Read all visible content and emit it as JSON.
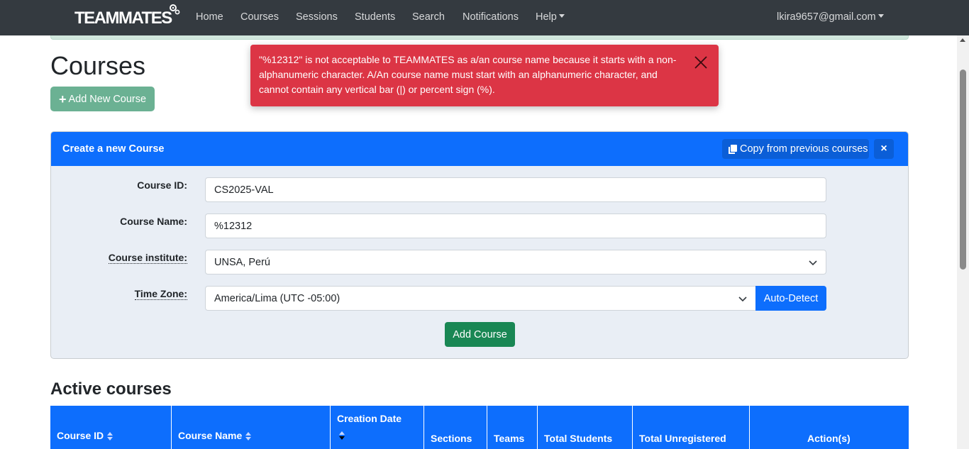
{
  "navbar": {
    "brand": "TEAMMATES",
    "links": [
      "Home",
      "Courses",
      "Sessions",
      "Students",
      "Search",
      "Notifications"
    ],
    "help": "Help",
    "user": "lkira9657@gmail.com"
  },
  "page": {
    "title": "Courses",
    "add_button": "Add New Course"
  },
  "toast": {
    "message": "\"%12312\" is not acceptable to TEAMMATES as a/an course name because it starts with a non-alphanumeric character. A/An course name must start with an alphanumeric character, and cannot contain any vertical bar (|) or percent sign (%).",
    "color": "#dc3545"
  },
  "form": {
    "title": "Create a new Course",
    "copy_button": "Copy from previous courses",
    "close_icon": "×",
    "course_id_label": "Course ID:",
    "course_id_value": "CS2025-VAL",
    "course_name_label": "Course Name:",
    "course_name_value": "%12312",
    "institute_label": "Course institute:",
    "institute_value": "UNSA, Perú",
    "timezone_label": "Time Zone:",
    "timezone_value": "America/Lima (UTC -05:00)",
    "auto_detect": "Auto-Detect",
    "submit": "Add Course"
  },
  "active": {
    "title": "Active courses",
    "columns": [
      "Course ID",
      "Course Name",
      "Creation Date",
      "Sections",
      "Teams",
      "Total Students",
      "Total Unregistered",
      "Action(s)"
    ]
  },
  "colors": {
    "navbar": "#343a40",
    "primary": "#0d6efd",
    "success": "#198754",
    "danger": "#dc3545"
  }
}
